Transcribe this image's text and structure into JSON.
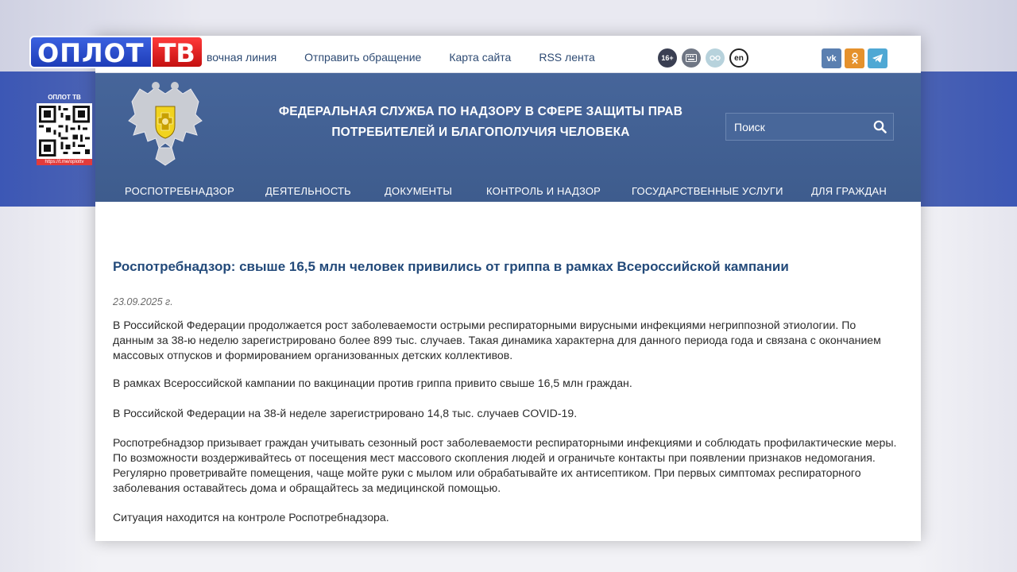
{
  "overlay": {
    "logo_left": "ОПЛОТ",
    "logo_right": "ТВ",
    "qr_caption": "ОПЛОТ ТВ",
    "qr_url": "https://t.me/oplottv"
  },
  "topbar": {
    "links": [
      "вочная линия",
      "Отправить обращение",
      "Карта сайта",
      "RSS лента"
    ],
    "badges": {
      "age": "16+",
      "lang": "en"
    },
    "social": [
      "vk",
      "ok",
      "telegram"
    ]
  },
  "header": {
    "title_line1": "ФЕДЕРАЛЬНАЯ СЛУЖБА ПО НАДЗОРУ В СФЕРЕ ЗАЩИТЫ ПРАВ",
    "title_line2": "ПОТРЕБИТЕЛЕЙ И БЛАГОПОЛУЧИЯ ЧЕЛОВЕКА",
    "search_placeholder": "Поиск"
  },
  "nav": {
    "items": [
      "РОСПОТРЕБНАДЗОР",
      "ДЕЯТЕЛЬНОСТЬ",
      "ДОКУМЕНТЫ",
      "КОНТРОЛЬ И НАДЗОР",
      "ГОСУДАРСТВЕННЫЕ УСЛУГИ",
      "ДЛЯ ГРАЖДАН"
    ]
  },
  "article": {
    "title": "Роспотребнадзор: свыше 16,5 млн человек привились от гриппа в рамках Всероссийской кампании",
    "date": "23.09.2025 г.",
    "p1_l1": "В Российской Федерации продолжается рост заболеваемости острыми респираторными вирусными инфекциями негриппозной этиологии. По",
    "p1_l2": "данным за 38-ю неделю зарегистрировано более 899 тыс. случаев. Такая динамика характерна для данного периода года и связана с окончанием",
    "p1_l3": "массовых отпусков и формированием организованных детских коллективов.",
    "p2": "В рамках Всероссийской кампании по вакцинации против гриппа привито свыше 16,5 млн граждан.",
    "p3": "В Российской Федерации на 38-й неделе зарегистрировано 14,8 тыс. случаев COVID-19.",
    "p4_l1": "Роспотребнадзор призывает граждан учитывать сезонный рост заболеваемости респираторными инфекциями и соблюдать профилактические меры.",
    "p4_l2": "По возможности воздерживайтесь от посещения мест массового скопления людей и ограничьте контакты при появлении признаков недомогания.",
    "p4_l3": "Регулярно проветривайте помещения, чаще мойте руки с мылом или обрабатывайте их антисептиком. При первых симптомах респираторного",
    "p4_l4": "заболевания оставайтесь дома и обращайтесь за медицинской помощью.",
    "p5": "Ситуация находится на контроле Роспотребнадзора."
  },
  "colors": {
    "header_blue": "#3f5f8f",
    "title_blue": "#234a7a",
    "link_blue": "#2d4a73"
  }
}
